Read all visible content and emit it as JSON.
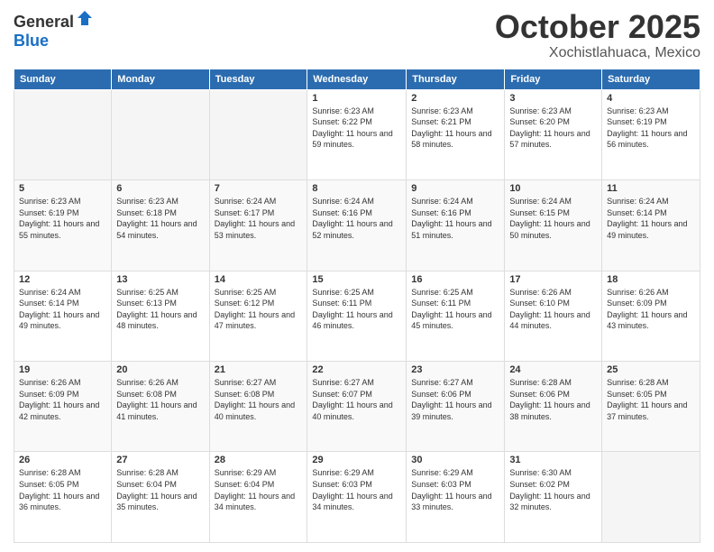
{
  "logo": {
    "general": "General",
    "blue": "Blue"
  },
  "header": {
    "month": "October 2025",
    "location": "Xochistlahuaca, Mexico"
  },
  "weekdays": [
    "Sunday",
    "Monday",
    "Tuesday",
    "Wednesday",
    "Thursday",
    "Friday",
    "Saturday"
  ],
  "weeks": [
    [
      {
        "day": "",
        "sunrise": "",
        "sunset": "",
        "daylight": ""
      },
      {
        "day": "",
        "sunrise": "",
        "sunset": "",
        "daylight": ""
      },
      {
        "day": "",
        "sunrise": "",
        "sunset": "",
        "daylight": ""
      },
      {
        "day": "1",
        "sunrise": "Sunrise: 6:23 AM",
        "sunset": "Sunset: 6:22 PM",
        "daylight": "Daylight: 11 hours and 59 minutes."
      },
      {
        "day": "2",
        "sunrise": "Sunrise: 6:23 AM",
        "sunset": "Sunset: 6:21 PM",
        "daylight": "Daylight: 11 hours and 58 minutes."
      },
      {
        "day": "3",
        "sunrise": "Sunrise: 6:23 AM",
        "sunset": "Sunset: 6:20 PM",
        "daylight": "Daylight: 11 hours and 57 minutes."
      },
      {
        "day": "4",
        "sunrise": "Sunrise: 6:23 AM",
        "sunset": "Sunset: 6:19 PM",
        "daylight": "Daylight: 11 hours and 56 minutes."
      }
    ],
    [
      {
        "day": "5",
        "sunrise": "Sunrise: 6:23 AM",
        "sunset": "Sunset: 6:19 PM",
        "daylight": "Daylight: 11 hours and 55 minutes."
      },
      {
        "day": "6",
        "sunrise": "Sunrise: 6:23 AM",
        "sunset": "Sunset: 6:18 PM",
        "daylight": "Daylight: 11 hours and 54 minutes."
      },
      {
        "day": "7",
        "sunrise": "Sunrise: 6:24 AM",
        "sunset": "Sunset: 6:17 PM",
        "daylight": "Daylight: 11 hours and 53 minutes."
      },
      {
        "day": "8",
        "sunrise": "Sunrise: 6:24 AM",
        "sunset": "Sunset: 6:16 PM",
        "daylight": "Daylight: 11 hours and 52 minutes."
      },
      {
        "day": "9",
        "sunrise": "Sunrise: 6:24 AM",
        "sunset": "Sunset: 6:16 PM",
        "daylight": "Daylight: 11 hours and 51 minutes."
      },
      {
        "day": "10",
        "sunrise": "Sunrise: 6:24 AM",
        "sunset": "Sunset: 6:15 PM",
        "daylight": "Daylight: 11 hours and 50 minutes."
      },
      {
        "day": "11",
        "sunrise": "Sunrise: 6:24 AM",
        "sunset": "Sunset: 6:14 PM",
        "daylight": "Daylight: 11 hours and 49 minutes."
      }
    ],
    [
      {
        "day": "12",
        "sunrise": "Sunrise: 6:24 AM",
        "sunset": "Sunset: 6:14 PM",
        "daylight": "Daylight: 11 hours and 49 minutes."
      },
      {
        "day": "13",
        "sunrise": "Sunrise: 6:25 AM",
        "sunset": "Sunset: 6:13 PM",
        "daylight": "Daylight: 11 hours and 48 minutes."
      },
      {
        "day": "14",
        "sunrise": "Sunrise: 6:25 AM",
        "sunset": "Sunset: 6:12 PM",
        "daylight": "Daylight: 11 hours and 47 minutes."
      },
      {
        "day": "15",
        "sunrise": "Sunrise: 6:25 AM",
        "sunset": "Sunset: 6:11 PM",
        "daylight": "Daylight: 11 hours and 46 minutes."
      },
      {
        "day": "16",
        "sunrise": "Sunrise: 6:25 AM",
        "sunset": "Sunset: 6:11 PM",
        "daylight": "Daylight: 11 hours and 45 minutes."
      },
      {
        "day": "17",
        "sunrise": "Sunrise: 6:26 AM",
        "sunset": "Sunset: 6:10 PM",
        "daylight": "Daylight: 11 hours and 44 minutes."
      },
      {
        "day": "18",
        "sunrise": "Sunrise: 6:26 AM",
        "sunset": "Sunset: 6:09 PM",
        "daylight": "Daylight: 11 hours and 43 minutes."
      }
    ],
    [
      {
        "day": "19",
        "sunrise": "Sunrise: 6:26 AM",
        "sunset": "Sunset: 6:09 PM",
        "daylight": "Daylight: 11 hours and 42 minutes."
      },
      {
        "day": "20",
        "sunrise": "Sunrise: 6:26 AM",
        "sunset": "Sunset: 6:08 PM",
        "daylight": "Daylight: 11 hours and 41 minutes."
      },
      {
        "day": "21",
        "sunrise": "Sunrise: 6:27 AM",
        "sunset": "Sunset: 6:08 PM",
        "daylight": "Daylight: 11 hours and 40 minutes."
      },
      {
        "day": "22",
        "sunrise": "Sunrise: 6:27 AM",
        "sunset": "Sunset: 6:07 PM",
        "daylight": "Daylight: 11 hours and 40 minutes."
      },
      {
        "day": "23",
        "sunrise": "Sunrise: 6:27 AM",
        "sunset": "Sunset: 6:06 PM",
        "daylight": "Daylight: 11 hours and 39 minutes."
      },
      {
        "day": "24",
        "sunrise": "Sunrise: 6:28 AM",
        "sunset": "Sunset: 6:06 PM",
        "daylight": "Daylight: 11 hours and 38 minutes."
      },
      {
        "day": "25",
        "sunrise": "Sunrise: 6:28 AM",
        "sunset": "Sunset: 6:05 PM",
        "daylight": "Daylight: 11 hours and 37 minutes."
      }
    ],
    [
      {
        "day": "26",
        "sunrise": "Sunrise: 6:28 AM",
        "sunset": "Sunset: 6:05 PM",
        "daylight": "Daylight: 11 hours and 36 minutes."
      },
      {
        "day": "27",
        "sunrise": "Sunrise: 6:28 AM",
        "sunset": "Sunset: 6:04 PM",
        "daylight": "Daylight: 11 hours and 35 minutes."
      },
      {
        "day": "28",
        "sunrise": "Sunrise: 6:29 AM",
        "sunset": "Sunset: 6:04 PM",
        "daylight": "Daylight: 11 hours and 34 minutes."
      },
      {
        "day": "29",
        "sunrise": "Sunrise: 6:29 AM",
        "sunset": "Sunset: 6:03 PM",
        "daylight": "Daylight: 11 hours and 34 minutes."
      },
      {
        "day": "30",
        "sunrise": "Sunrise: 6:29 AM",
        "sunset": "Sunset: 6:03 PM",
        "daylight": "Daylight: 11 hours and 33 minutes."
      },
      {
        "day": "31",
        "sunrise": "Sunrise: 6:30 AM",
        "sunset": "Sunset: 6:02 PM",
        "daylight": "Daylight: 11 hours and 32 minutes."
      },
      {
        "day": "",
        "sunrise": "",
        "sunset": "",
        "daylight": ""
      }
    ]
  ]
}
